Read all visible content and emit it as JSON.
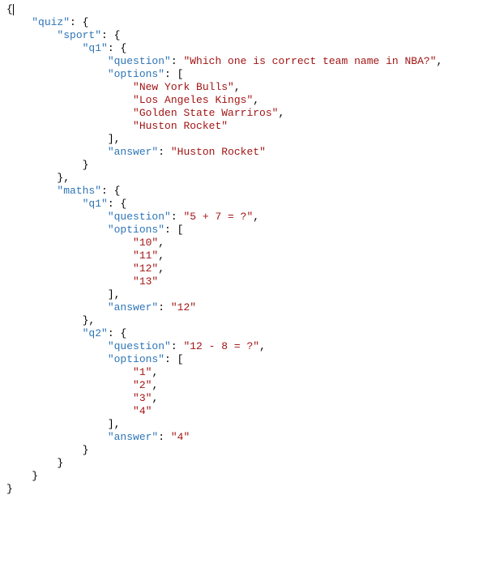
{
  "chart_data": {
    "type": "table",
    "title": "JSON quiz data structure",
    "json": {
      "quiz": {
        "sport": {
          "q1": {
            "question": "Which one is correct team name in NBA?",
            "options": [
              "New York Bulls",
              "Los Angeles Kings",
              "Golden State Warriros",
              "Huston Rocket"
            ],
            "answer": "Huston Rocket"
          }
        },
        "maths": {
          "q1": {
            "question": "5 + 7 = ?",
            "options": [
              "10",
              "11",
              "12",
              "13"
            ],
            "answer": "12"
          },
          "q2": {
            "question": "12 - 8 = ?",
            "options": [
              "1",
              "2",
              "3",
              "4"
            ],
            "answer": "4"
          }
        }
      }
    }
  },
  "tokens": [
    {
      "t": "{",
      "c": "punct",
      "cursor": true
    },
    {
      "t": "\n"
    },
    {
      "t": "    "
    },
    {
      "t": "\"quiz\"",
      "c": "key"
    },
    {
      "t": ": {",
      "c": "punct"
    },
    {
      "t": "\n"
    },
    {
      "t": "        "
    },
    {
      "t": "\"sport\"",
      "c": "key"
    },
    {
      "t": ": {",
      "c": "punct"
    },
    {
      "t": "\n"
    },
    {
      "t": "            "
    },
    {
      "t": "\"q1\"",
      "c": "key"
    },
    {
      "t": ": {",
      "c": "punct"
    },
    {
      "t": "\n"
    },
    {
      "t": "                "
    },
    {
      "t": "\"question\"",
      "c": "key"
    },
    {
      "t": ": ",
      "c": "punct"
    },
    {
      "t": "\"Which one is correct team name in NBA?\"",
      "c": "str"
    },
    {
      "t": ",",
      "c": "punct"
    },
    {
      "t": "\n"
    },
    {
      "t": "                "
    },
    {
      "t": "\"options\"",
      "c": "key"
    },
    {
      "t": ": [",
      "c": "punct"
    },
    {
      "t": "\n"
    },
    {
      "t": "                    "
    },
    {
      "t": "\"New York Bulls\"",
      "c": "str"
    },
    {
      "t": ",",
      "c": "punct"
    },
    {
      "t": "\n"
    },
    {
      "t": "                    "
    },
    {
      "t": "\"Los Angeles Kings\"",
      "c": "str"
    },
    {
      "t": ",",
      "c": "punct"
    },
    {
      "t": "\n"
    },
    {
      "t": "                    "
    },
    {
      "t": "\"Golden State Warriros\"",
      "c": "str"
    },
    {
      "t": ",",
      "c": "punct"
    },
    {
      "t": "\n"
    },
    {
      "t": "                    "
    },
    {
      "t": "\"Huston Rocket\"",
      "c": "str"
    },
    {
      "t": "\n"
    },
    {
      "t": "                ],",
      "c": "punct"
    },
    {
      "t": "\n"
    },
    {
      "t": "                "
    },
    {
      "t": "\"answer\"",
      "c": "key"
    },
    {
      "t": ": ",
      "c": "punct"
    },
    {
      "t": "\"Huston Rocket\"",
      "c": "str"
    },
    {
      "t": "\n"
    },
    {
      "t": "            }",
      "c": "punct"
    },
    {
      "t": "\n"
    },
    {
      "t": "        },",
      "c": "punct"
    },
    {
      "t": "\n"
    },
    {
      "t": "        "
    },
    {
      "t": "\"maths\"",
      "c": "key"
    },
    {
      "t": ": {",
      "c": "punct"
    },
    {
      "t": "\n"
    },
    {
      "t": "            "
    },
    {
      "t": "\"q1\"",
      "c": "key"
    },
    {
      "t": ": {",
      "c": "punct"
    },
    {
      "t": "\n"
    },
    {
      "t": "                "
    },
    {
      "t": "\"question\"",
      "c": "key"
    },
    {
      "t": ": ",
      "c": "punct"
    },
    {
      "t": "\"5 + 7 = ?\"",
      "c": "str"
    },
    {
      "t": ",",
      "c": "punct"
    },
    {
      "t": "\n"
    },
    {
      "t": "                "
    },
    {
      "t": "\"options\"",
      "c": "key"
    },
    {
      "t": ": [",
      "c": "punct"
    },
    {
      "t": "\n"
    },
    {
      "t": "                    "
    },
    {
      "t": "\"10\"",
      "c": "str"
    },
    {
      "t": ",",
      "c": "punct"
    },
    {
      "t": "\n"
    },
    {
      "t": "                    "
    },
    {
      "t": "\"11\"",
      "c": "str"
    },
    {
      "t": ",",
      "c": "punct"
    },
    {
      "t": "\n"
    },
    {
      "t": "                    "
    },
    {
      "t": "\"12\"",
      "c": "str"
    },
    {
      "t": ",",
      "c": "punct"
    },
    {
      "t": "\n"
    },
    {
      "t": "                    "
    },
    {
      "t": "\"13\"",
      "c": "str"
    },
    {
      "t": "\n"
    },
    {
      "t": "                ],",
      "c": "punct"
    },
    {
      "t": "\n"
    },
    {
      "t": "                "
    },
    {
      "t": "\"answer\"",
      "c": "key"
    },
    {
      "t": ": ",
      "c": "punct"
    },
    {
      "t": "\"12\"",
      "c": "str"
    },
    {
      "t": "\n"
    },
    {
      "t": "            },",
      "c": "punct"
    },
    {
      "t": "\n"
    },
    {
      "t": "            "
    },
    {
      "t": "\"q2\"",
      "c": "key"
    },
    {
      "t": ": {",
      "c": "punct"
    },
    {
      "t": "\n"
    },
    {
      "t": "                "
    },
    {
      "t": "\"question\"",
      "c": "key"
    },
    {
      "t": ": ",
      "c": "punct"
    },
    {
      "t": "\"12 - 8 = ?\"",
      "c": "str"
    },
    {
      "t": ",",
      "c": "punct"
    },
    {
      "t": "\n"
    },
    {
      "t": "                "
    },
    {
      "t": "\"options\"",
      "c": "key"
    },
    {
      "t": ": [",
      "c": "punct"
    },
    {
      "t": "\n"
    },
    {
      "t": "                    "
    },
    {
      "t": "\"1\"",
      "c": "str"
    },
    {
      "t": ",",
      "c": "punct"
    },
    {
      "t": "\n"
    },
    {
      "t": "                    "
    },
    {
      "t": "\"2\"",
      "c": "str"
    },
    {
      "t": ",",
      "c": "punct"
    },
    {
      "t": "\n"
    },
    {
      "t": "                    "
    },
    {
      "t": "\"3\"",
      "c": "str"
    },
    {
      "t": ",",
      "c": "punct"
    },
    {
      "t": "\n"
    },
    {
      "t": "                    "
    },
    {
      "t": "\"4\"",
      "c": "str"
    },
    {
      "t": "\n"
    },
    {
      "t": "                ],",
      "c": "punct"
    },
    {
      "t": "\n"
    },
    {
      "t": "                "
    },
    {
      "t": "\"answer\"",
      "c": "key"
    },
    {
      "t": ": ",
      "c": "punct"
    },
    {
      "t": "\"4\"",
      "c": "str"
    },
    {
      "t": "\n"
    },
    {
      "t": "            }",
      "c": "punct"
    },
    {
      "t": "\n"
    },
    {
      "t": "        }",
      "c": "punct"
    },
    {
      "t": "\n"
    },
    {
      "t": "    }",
      "c": "punct"
    },
    {
      "t": "\n"
    },
    {
      "t": "}",
      "c": "punct"
    }
  ]
}
